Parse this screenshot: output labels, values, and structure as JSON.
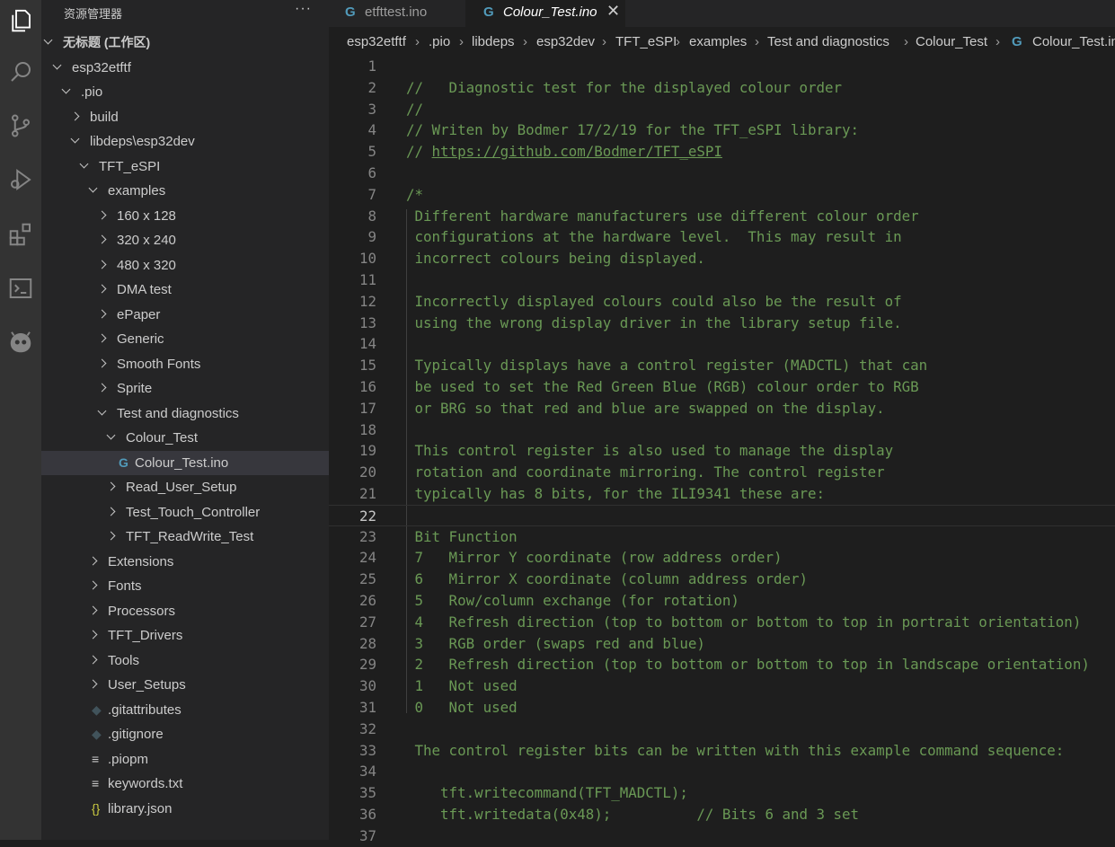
{
  "explorer": {
    "title": "资源管理器",
    "more": "···",
    "tree": [
      {
        "label": "无标题 (工作区)",
        "type": "folder",
        "open": true,
        "level": 0,
        "bold": true
      },
      {
        "label": "esp32etftf",
        "type": "folder",
        "open": true,
        "level": 1
      },
      {
        "label": ".pio",
        "type": "folder",
        "open": true,
        "level": 2
      },
      {
        "label": "build",
        "type": "folder",
        "open": false,
        "level": 3
      },
      {
        "label": "libdeps\\esp32dev",
        "type": "folder",
        "open": true,
        "level": 3
      },
      {
        "label": "TFT_eSPI",
        "type": "folder",
        "open": true,
        "level": 4
      },
      {
        "label": "examples",
        "type": "folder",
        "open": true,
        "level": 5
      },
      {
        "label": "160 x 128",
        "type": "folder",
        "open": false,
        "level": 6
      },
      {
        "label": "320 x 240",
        "type": "folder",
        "open": false,
        "level": 6
      },
      {
        "label": "480 x 320",
        "type": "folder",
        "open": false,
        "level": 6
      },
      {
        "label": "DMA test",
        "type": "folder",
        "open": false,
        "level": 6
      },
      {
        "label": "ePaper",
        "type": "folder",
        "open": false,
        "level": 6
      },
      {
        "label": "Generic",
        "type": "folder",
        "open": false,
        "level": 6
      },
      {
        "label": "Smooth Fonts",
        "type": "folder",
        "open": false,
        "level": 6
      },
      {
        "label": "Sprite",
        "type": "folder",
        "open": false,
        "level": 6
      },
      {
        "label": "Test and diagnostics",
        "type": "folder",
        "open": true,
        "level": 6
      },
      {
        "label": "Colour_Test",
        "type": "folder",
        "open": true,
        "level": 7
      },
      {
        "label": "Colour_Test.ino",
        "type": "file",
        "icon": "cpp",
        "level": 8,
        "selected": true
      },
      {
        "label": "Read_User_Setup",
        "type": "folder",
        "open": false,
        "level": 7
      },
      {
        "label": "Test_Touch_Controller",
        "type": "folder",
        "open": false,
        "level": 7
      },
      {
        "label": "TFT_ReadWrite_Test",
        "type": "folder",
        "open": false,
        "level": 7
      },
      {
        "label": "Extensions",
        "type": "folder",
        "open": false,
        "level": 5
      },
      {
        "label": "Fonts",
        "type": "folder",
        "open": false,
        "level": 5
      },
      {
        "label": "Processors",
        "type": "folder",
        "open": false,
        "level": 5
      },
      {
        "label": "TFT_Drivers",
        "type": "folder",
        "open": false,
        "level": 5
      },
      {
        "label": "Tools",
        "type": "folder",
        "open": false,
        "level": 5
      },
      {
        "label": "User_Setups",
        "type": "folder",
        "open": false,
        "level": 5
      },
      {
        "label": ".gitattributes",
        "type": "file",
        "icon": "git",
        "level": 5
      },
      {
        "label": ".gitignore",
        "type": "file",
        "icon": "git",
        "level": 5
      },
      {
        "label": ".piopm",
        "type": "file",
        "icon": "lines",
        "level": 5
      },
      {
        "label": "keywords.txt",
        "type": "file",
        "icon": "lines",
        "level": 5
      },
      {
        "label": "library.json",
        "type": "file",
        "icon": "json",
        "level": 5
      }
    ]
  },
  "tabs": [
    {
      "label": "etfttest.ino",
      "active": false
    },
    {
      "label": "Colour_Test.ino",
      "active": true
    }
  ],
  "breadcrumb": [
    "esp32etftf",
    ".pio",
    "libdeps",
    "esp32dev",
    "TFT_eSPI",
    "examples",
    "Test and diagnostics",
    "Colour_Test",
    "Colour_Test.ino"
  ],
  "code": {
    "current_line": 22,
    "lines": [
      {
        "n": "1",
        "kind": "blank",
        "text": ""
      },
      {
        "n": "2",
        "kind": "comment",
        "text": "//   Diagnostic test for the displayed colour order"
      },
      {
        "n": "3",
        "kind": "comment",
        "text": "//"
      },
      {
        "n": "4",
        "kind": "comment",
        "text": "// Writen by Bodmer 17/2/19 for the TFT_eSPI library:"
      },
      {
        "n": "5",
        "kind": "link",
        "text": "// ",
        "link": "https://github.com/Bodmer/TFT_eSPI"
      },
      {
        "n": "6",
        "kind": "blank",
        "text": ""
      },
      {
        "n": "7",
        "kind": "comment",
        "text": "/*"
      },
      {
        "n": "8",
        "kind": "comment",
        "text": " Different hardware manufacturers use different colour order"
      },
      {
        "n": "9",
        "kind": "comment",
        "text": " configurations at the hardware level.  This may result in"
      },
      {
        "n": "10",
        "kind": "comment",
        "text": " incorrect colours being displayed."
      },
      {
        "n": "11",
        "kind": "blank",
        "text": ""
      },
      {
        "n": "12",
        "kind": "comment",
        "text": " Incorrectly displayed colours could also be the result of"
      },
      {
        "n": "13",
        "kind": "comment",
        "text": " using the wrong display driver in the library setup file."
      },
      {
        "n": "14",
        "kind": "blank",
        "text": ""
      },
      {
        "n": "15",
        "kind": "comment",
        "text": " Typically displays have a control register (MADCTL) that can"
      },
      {
        "n": "16",
        "kind": "comment",
        "text": " be used to set the Red Green Blue (RGB) colour order to RGB"
      },
      {
        "n": "17",
        "kind": "comment",
        "text": " or BRG so that red and blue are swapped on the display."
      },
      {
        "n": "18",
        "kind": "blank",
        "text": ""
      },
      {
        "n": "19",
        "kind": "comment",
        "text": " This control register is also used to manage the display"
      },
      {
        "n": "20",
        "kind": "comment",
        "text": " rotation and coordinate mirroring. The control register"
      },
      {
        "n": "21",
        "kind": "comment",
        "text": " typically has 8 bits, for the ILI9341 these are:"
      },
      {
        "n": "22",
        "kind": "blank",
        "text": ""
      },
      {
        "n": "23",
        "kind": "comment",
        "text": " Bit Function"
      },
      {
        "n": "24",
        "kind": "comment",
        "text": " 7   Mirror Y coordinate (row address order)"
      },
      {
        "n": "25",
        "kind": "comment",
        "text": " 6   Mirror X coordinate (column address order)"
      },
      {
        "n": "26",
        "kind": "comment",
        "text": " 5   Row/column exchange (for rotation)"
      },
      {
        "n": "27",
        "kind": "comment",
        "text": " 4   Refresh direction (top to bottom or bottom to top in portrait orientation)"
      },
      {
        "n": "28",
        "kind": "comment",
        "text": " 3   RGB order (swaps red and blue)"
      },
      {
        "n": "29",
        "kind": "comment",
        "text": " 2   Refresh direction (top to bottom or bottom to top in landscape orientation)"
      },
      {
        "n": "30",
        "kind": "comment",
        "text": " 1   Not used"
      },
      {
        "n": "31",
        "kind": "comment",
        "text": " 0   Not used"
      },
      {
        "n": "32",
        "kind": "blank",
        "text": ""
      },
      {
        "n": "33",
        "kind": "comment",
        "text": " The control register bits can be written with this example command sequence:"
      },
      {
        "n": "34",
        "kind": "blank",
        "text": ""
      },
      {
        "n": "35",
        "kind": "comment",
        "text": "    tft.writecommand(TFT_MADCTL);"
      },
      {
        "n": "36",
        "kind": "comment",
        "text": "    tft.writedata(0x48);          // Bits 6 and 3 set"
      },
      {
        "n": "37",
        "kind": "blank",
        "text": ""
      }
    ]
  },
  "activity_bar": [
    "files-icon",
    "search-icon",
    "source-control-icon",
    "run-debug-icon",
    "extensions-icon",
    "terminal-icon",
    "platformio-icon"
  ],
  "colors": {
    "comment": "#6a9955",
    "line_number": "#858585",
    "sidebar_bg": "#252526",
    "editor_bg": "#1e1e1e",
    "activity_bg": "#333333",
    "cpp_icon": "#519aba"
  }
}
